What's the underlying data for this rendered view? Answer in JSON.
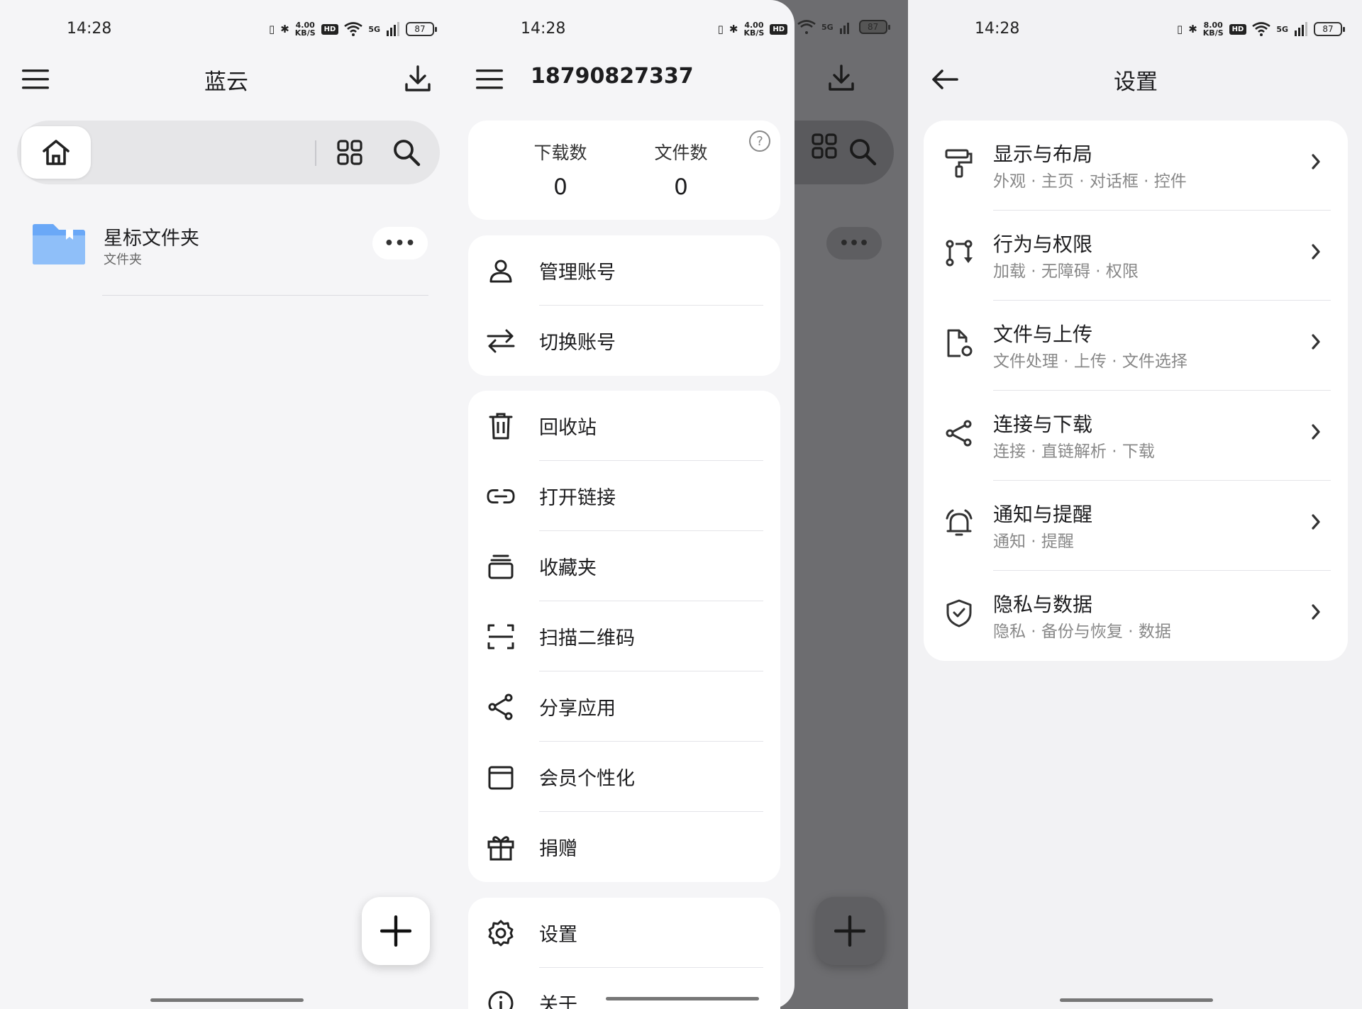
{
  "status": {
    "time": "14:28",
    "speed_1": "4.00\nKB/S",
    "speed_2": "4.00\nKB/S",
    "speed_3": "8.00\nKB/S",
    "hd": "HD",
    "net": "5G",
    "battery": "87"
  },
  "home": {
    "title": "蓝云",
    "folder": {
      "name": "星标文件夹",
      "type": "文件夹"
    },
    "more": "•••"
  },
  "drawer": {
    "account": "18790827337",
    "stats": [
      {
        "label": "下载数",
        "value": "0"
      },
      {
        "label": "文件数",
        "value": "0"
      }
    ],
    "help": "?",
    "group1": [
      {
        "label": "管理账号",
        "icon": "person-icon"
      },
      {
        "label": "切换账号",
        "icon": "swap-icon"
      }
    ],
    "group2": [
      {
        "label": "回收站",
        "icon": "trash-icon"
      },
      {
        "label": "打开链接",
        "icon": "link-icon"
      },
      {
        "label": "收藏夹",
        "icon": "collection-icon"
      },
      {
        "label": "扫描二维码",
        "icon": "scan-icon"
      },
      {
        "label": "分享应用",
        "icon": "share-icon"
      },
      {
        "label": "会员个性化",
        "icon": "wallet-icon"
      },
      {
        "label": "捐赠",
        "icon": "gift-icon"
      }
    ],
    "group3": [
      {
        "label": "设置",
        "icon": "gear-icon"
      },
      {
        "label": "关于",
        "icon": "info-icon"
      }
    ]
  },
  "settings": {
    "title": "设置",
    "items": [
      {
        "title": "显示与布局",
        "sub": "外观 · 主页 · 对话框 · 控件",
        "icon": "paint-roller-icon"
      },
      {
        "title": "行为与权限",
        "sub": "加载 · 无障碍 · 权限",
        "icon": "route-icon"
      },
      {
        "title": "文件与上传",
        "sub": "文件处理 · 上传 · 文件选择",
        "icon": "file-settings-icon"
      },
      {
        "title": "连接与下载",
        "sub": "连接 · 直链解析 · 下载",
        "icon": "share-nodes-icon"
      },
      {
        "title": "通知与提醒",
        "sub": "通知 · 提醒",
        "icon": "bell-ring-icon"
      },
      {
        "title": "隐私与数据",
        "sub": "隐私 · 备份与恢复 · 数据",
        "icon": "shield-check-icon"
      }
    ]
  }
}
